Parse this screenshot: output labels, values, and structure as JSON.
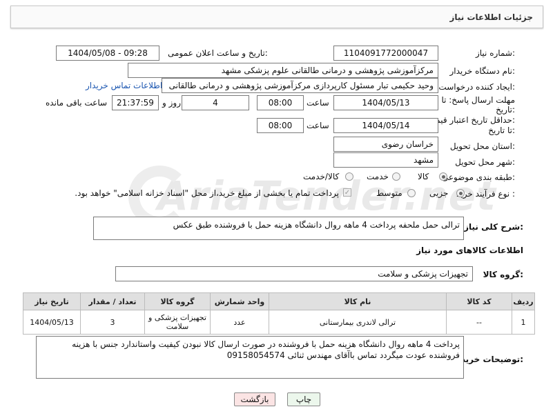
{
  "header": {
    "title": "جزئیات اطلاعات نیاز"
  },
  "fields": {
    "need_number_label": "شماره نیاز:",
    "need_number": "1104091772000047",
    "announce_label": "تاریخ و ساعت اعلان عمومی:",
    "announce_value": "1404/05/08 - 09:28",
    "buyer_org_label": "نام دستگاه خریدار:",
    "buyer_org": "مرکزآموزشی  پژوهشی و درمانی طالقانی   علوم پزشکی مشهد",
    "creator_label": "ایجاد کننده درخواست:",
    "creator": "وحید حکیمی تبار مسئول کارپردازی مرکزآموزشی  پژوهشی و درمانی طالقانی",
    "buyer_contact_link": "اطلاعات تماس خریدار",
    "deadline_label_1": "مهلت ارسال پاسخ: تا",
    "deadline_label_2": "تاریخ:",
    "deadline_date": "1404/05/13",
    "hour_label": "ساعت",
    "deadline_hour": "08:00",
    "days_value": "4",
    "days_label": "روز و",
    "remaining_time": "21:37:59",
    "remaining_label": "ساعت باقی مانده",
    "validity_label_1": "حداقل تاریخ اعتبار قیمت:",
    "validity_label_2": "تا تاریخ:",
    "validity_date": "1404/05/14",
    "validity_hour": "08:00",
    "province_label": "استان محل تحویل:",
    "province": "خراسان رضوی",
    "city_label": "شهر محل تحویل:",
    "city": "مشهد",
    "category_label": "طبقه بندی موضوعی:",
    "category_options": [
      "کالا",
      "خدمت",
      "کالا/خدمت"
    ],
    "category_selected": "کالا",
    "process_label": "نوع فرآیند خرید :",
    "process_options": [
      "جزیی",
      "متوسط"
    ],
    "process_selected": "جزیی",
    "payment_note": "پرداخت تمام یا بخشی از مبلغ خرید،از محل \"اسناد خزانه اسلامی\" خواهد بود."
  },
  "description": {
    "label": "شرح کلی نیاز:",
    "text": "ترالی حمل ملحفه پرداخت 4 ماهه روال دانشگاه هزینه حمل با فروشنده طبق عکس"
  },
  "goods_section_title": "اطلاعات کالاهای مورد نیاز",
  "goods_group": {
    "label": "گروه کالا:",
    "value": "تجهیزات پزشکی و سلامت"
  },
  "table": {
    "headers": [
      "ردیف",
      "کد کالا",
      "نام کالا",
      "واحد شمارش",
      "گروه کالا",
      "تعداد / مقدار",
      "تاریخ نیاز"
    ],
    "rows": [
      [
        "1",
        "--",
        "ترالی لاندری بیمارستانی",
        "عدد",
        "تجهیزات پزشکی و سلامت",
        "3",
        "1404/05/13"
      ]
    ]
  },
  "buyer_notes": {
    "label": "توضیحات خریدار:",
    "text": "پرداخت 4 ماهه روال دانشگاه هزینه حمل با فروشنده در صورت ارسال کالا نبودن کیفیت واستاندارد جنس با هزینه فروشنده عودت میگردد تماس باآقای مهندس ثنائی 09158054574"
  },
  "buttons": {
    "print": "چاپ",
    "back": "بازگشت"
  },
  "watermark": "AriaTender.net"
}
